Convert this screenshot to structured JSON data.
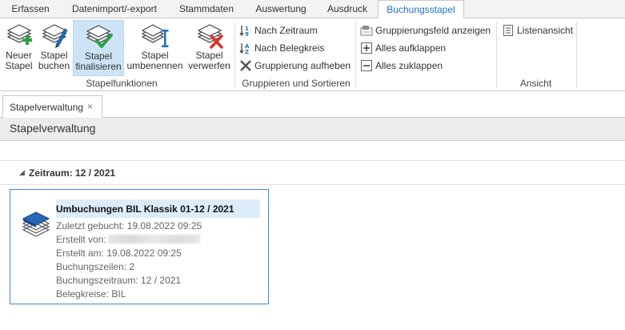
{
  "ribbon_tabs": [
    {
      "label": "Erfassen",
      "active": false
    },
    {
      "label": "Datenimport/-export",
      "active": false
    },
    {
      "label": "Stammdaten",
      "active": false
    },
    {
      "label": "Auswertung",
      "active": false
    },
    {
      "label": "Ausdruck",
      "active": false
    },
    {
      "label": "Buchungsstapel",
      "active": true
    }
  ],
  "stapelfunktionen": {
    "group_label": "Stapelfunktionen",
    "buttons": [
      {
        "line1": "Neuer",
        "line2": "Stapel",
        "icon": "new-stack-icon"
      },
      {
        "line1": "Stapel",
        "line2": "buchen",
        "icon": "book-stack-icon"
      },
      {
        "line1": "Stapel",
        "line2": "finalisieren",
        "icon": "finalize-stack-icon",
        "selected": true
      },
      {
        "line1": "Stapel",
        "line2": "umbenennen",
        "icon": "rename-stack-icon"
      },
      {
        "line1": "Stapel",
        "line2": "verwerfen",
        "icon": "discard-stack-icon"
      }
    ]
  },
  "gruppieren": {
    "group_label": "Gruppieren und Sortieren",
    "items": [
      {
        "label": "Nach Zeitraum",
        "icon": "sort-numeric-icon"
      },
      {
        "label": "Nach Belegkreis",
        "icon": "sort-alpha-icon"
      },
      {
        "label": "Gruppierung aufheben",
        "icon": "remove-grouping-icon"
      }
    ]
  },
  "ansicht_ops": {
    "items": [
      {
        "label": "Gruppierungsfeld anzeigen",
        "icon": "grouping-field-icon"
      },
      {
        "label": "Alles aufklappen",
        "icon": "expand-all-icon"
      },
      {
        "label": "Alles zuklappen",
        "icon": "collapse-all-icon"
      }
    ]
  },
  "ansicht": {
    "group_label": "Ansicht",
    "items": [
      {
        "label": "Listenansicht",
        "icon": "list-view-icon"
      }
    ]
  },
  "doc_tab": {
    "label": "Stapelverwaltung",
    "close": "×"
  },
  "header": {
    "title": "Stapelverwaltung"
  },
  "group_row": {
    "text": "Zeitraum: 12 / 2021",
    "arrow": "◢"
  },
  "card": {
    "title": "Umbuchungen BIL Klassik 01-12 / 2021",
    "zuletzt": "Zuletzt gebucht: 19.08.2022 09:25",
    "erstellt_von": "Erstellt von:",
    "erstellt_am": "Erstellt am: 19.08.2022 09:25",
    "buchungszeilen": "Buchungszeilen: 2",
    "buchungszeitraum": "Buchungszeitraum: 12 / 2021",
    "belegkreise": "Belegkreise: BIL"
  },
  "colors": {
    "accent": "#1e6fc2",
    "selection": "#cde4f7",
    "card_border": "#3b8ad6",
    "check_green": "#2ea043",
    "discard_red": "#d9342b"
  }
}
